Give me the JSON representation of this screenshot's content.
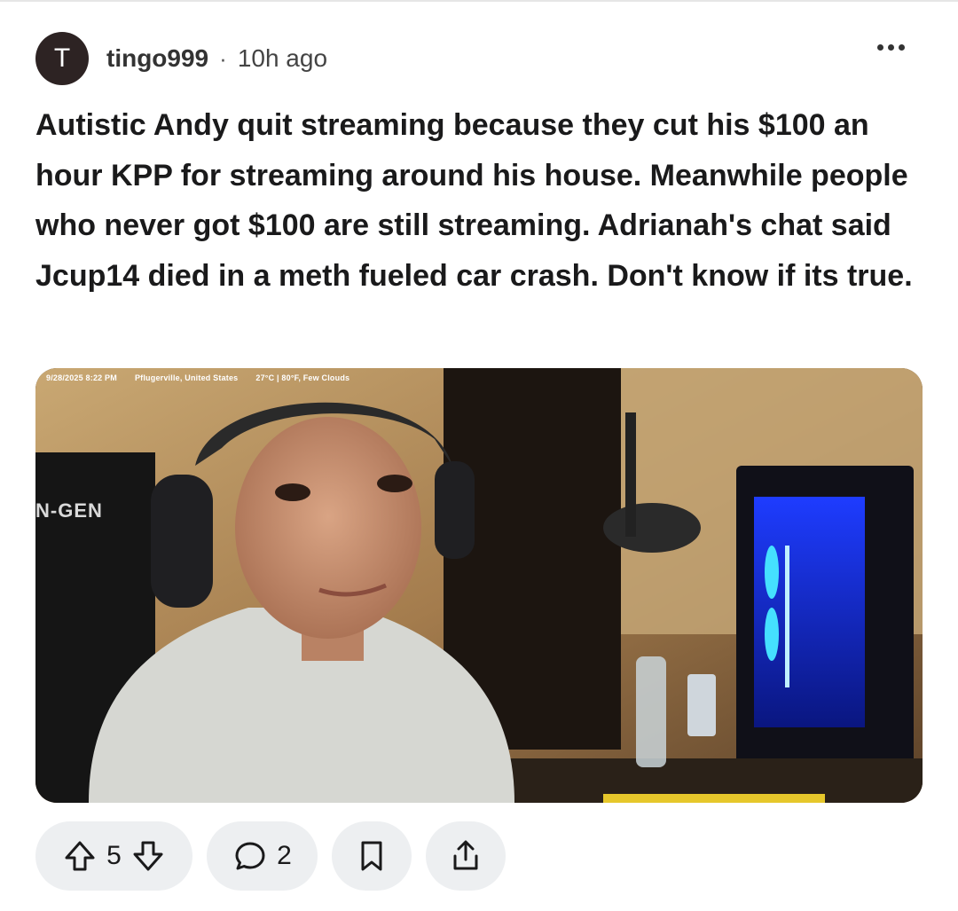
{
  "post": {
    "avatar_letter": "T",
    "author": "tingo999",
    "separator": "·",
    "time": "10h ago",
    "body": "Autistic Andy quit streaming because they cut his $100 an hour KPP for streaming around his house. Meanwhile people who never got $100 are still streaming. Adrianah's chat said Jcup14 died in a meth fueled car crash. Don't know if its true."
  },
  "media": {
    "overlay": {
      "datetime": "9/28/2025 8:22 PM",
      "location": "Pflugerville, United States",
      "weather": "27°C | 80°F, Few Clouds"
    },
    "chair_brand": "N-GEN"
  },
  "actions": {
    "vote_count": "5",
    "comment_count": "2"
  },
  "icons": {
    "more": "more-horizontal-icon",
    "upvote": "arrow-up-icon",
    "downvote": "arrow-down-icon",
    "comment": "comment-bubble-icon",
    "save": "bookmark-icon",
    "share": "share-icon"
  },
  "colors": {
    "pill_bg": "#edeff1",
    "avatar_bg": "#2d2323",
    "text": "#1a1a1b"
  }
}
